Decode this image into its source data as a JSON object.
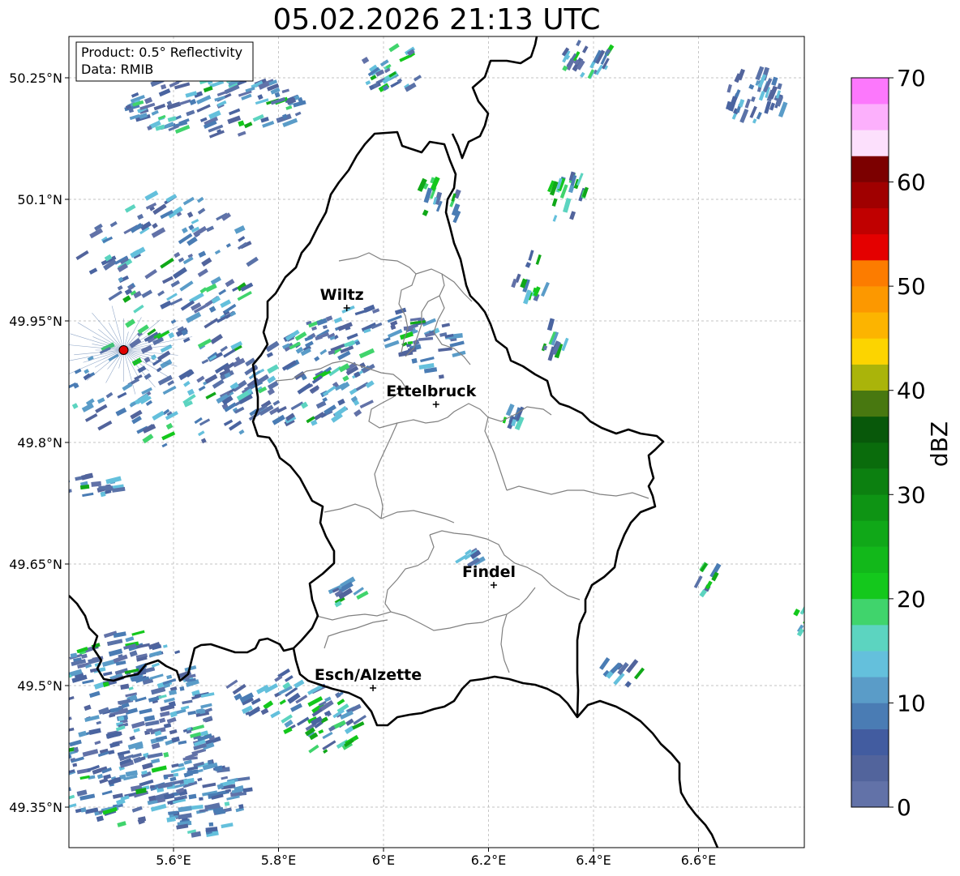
{
  "title": "05.02.2026 21:13 UTC",
  "info_box": {
    "product": "Product: 0.5° Reflectivity",
    "data": "Data: RMIB"
  },
  "lat_ticks": [
    "50.25°N",
    "50.1°N",
    "49.95°N",
    "49.8°N",
    "49.65°N",
    "49.5°N",
    "49.35°N"
  ],
  "lon_ticks": [
    "5.6°E",
    "5.8°E",
    "6°E",
    "6.2°E",
    "6.4°E",
    "6.6°E"
  ],
  "cities": [
    {
      "name": "Wiltz",
      "lon": 5.93,
      "lat": 49.966
    },
    {
      "name": "Ettelbruck",
      "lon": 6.1,
      "lat": 49.847
    },
    {
      "name": "Findel",
      "lon": 6.21,
      "lat": 49.624
    },
    {
      "name": "Esch/Alzette",
      "lon": 5.98,
      "lat": 49.497
    }
  ],
  "radar_site": {
    "lon": 5.505,
    "lat": 49.914
  },
  "colorbar": {
    "label": "dBZ",
    "ticks": [
      "0",
      "10",
      "20",
      "30",
      "40",
      "50",
      "60",
      "70"
    ],
    "colors": [
      "#6272a8",
      "#52649c",
      "#425ca0",
      "#4a7cb4",
      "#5a9cc8",
      "#64c0dc",
      "#5cd4c0",
      "#40d46c",
      "#14c81c",
      "#12b81a",
      "#10a818",
      "#0e9414",
      "#0c8010",
      "#0a6c0c",
      "#08580a",
      "#487810",
      "#aab40a",
      "#fcd400",
      "#fcb400",
      "#fc9800",
      "#fc7c00",
      "#e40000",
      "#c00000",
      "#a00000",
      "#7c0000",
      "#fce0fc",
      "#fcb0fc",
      "#fc78fc",
      "#e83ce8"
    ]
  }
}
